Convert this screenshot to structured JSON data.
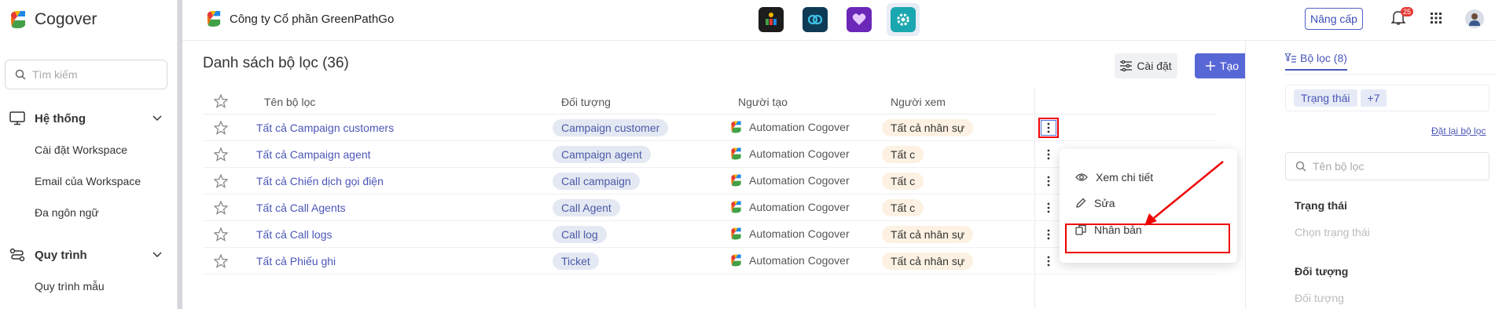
{
  "sidebar": {
    "brand": "Cogover",
    "search_placeholder": "Tìm kiếm",
    "groups": [
      {
        "label": "Hệ thống",
        "items": [
          "Cài đặt Workspace",
          "Email của Workspace",
          "Đa ngôn ngữ"
        ]
      },
      {
        "label": "Quy trình",
        "items": [
          "Quy trình mẫu"
        ]
      }
    ]
  },
  "topbar": {
    "company": "Công ty Cổ phần GreenPathGo",
    "upgrade_label": "Nâng cấp",
    "notification_count": "25",
    "app_icons": [
      "org-chart-app-icon",
      "link-app-icon",
      "heart-app-icon",
      "settings-app-icon"
    ]
  },
  "main": {
    "title": "Danh sách bộ lọc (36)",
    "settings_label": "Cài đặt",
    "create_label": "Tạo",
    "columns": {
      "name": "Tên bộ lọc",
      "object": "Đối tượng",
      "creator": "Người tạo",
      "viewer": "Người xem"
    },
    "rows": [
      {
        "name": "Tất cả Campaign customers",
        "object": "Campaign customer",
        "creator": "Automation Cogover",
        "viewer": "Tất cả nhân sự"
      },
      {
        "name": "Tất cả Campaign agent",
        "object": "Campaign agent",
        "creator": "Automation Cogover",
        "viewer": "Tất c"
      },
      {
        "name": "Tất cả Chiến dịch gọi điện",
        "object": "Call campaign",
        "creator": "Automation Cogover",
        "viewer": "Tất c"
      },
      {
        "name": "Tất cả Call Agents",
        "object": "Call Agent",
        "creator": "Automation Cogover",
        "viewer": "Tất c"
      },
      {
        "name": "Tất cả Call logs",
        "object": "Call log",
        "creator": "Automation Cogover",
        "viewer": "Tất cả nhân sự"
      },
      {
        "name": "Tất cả Phiếu ghi",
        "object": "Ticket",
        "creator": "Automation Cogover",
        "viewer": "Tất cả nhân sự"
      }
    ],
    "row_menu": [
      "Xem chi tiết",
      "Sửa",
      "Nhân bản"
    ]
  },
  "filter_panel": {
    "tab_label": "Bộ lọc (8)",
    "chips": [
      "Trạng thái",
      "+7"
    ],
    "reset_label": "Đặt lại bộ lọc",
    "search_placeholder": "Tên bộ lọc",
    "fields": [
      {
        "label": "Trạng thái",
        "placeholder": "Chọn trạng thái"
      },
      {
        "label": "Đối tượng",
        "placeholder": "Đối tượng"
      }
    ]
  },
  "colors": {
    "accent": "#5867d6",
    "link": "#4a56b8",
    "highlight": "#e00000",
    "object_tag_bg": "#e4e8f2",
    "viewer_tag_bg": "#fcf1e2"
  }
}
